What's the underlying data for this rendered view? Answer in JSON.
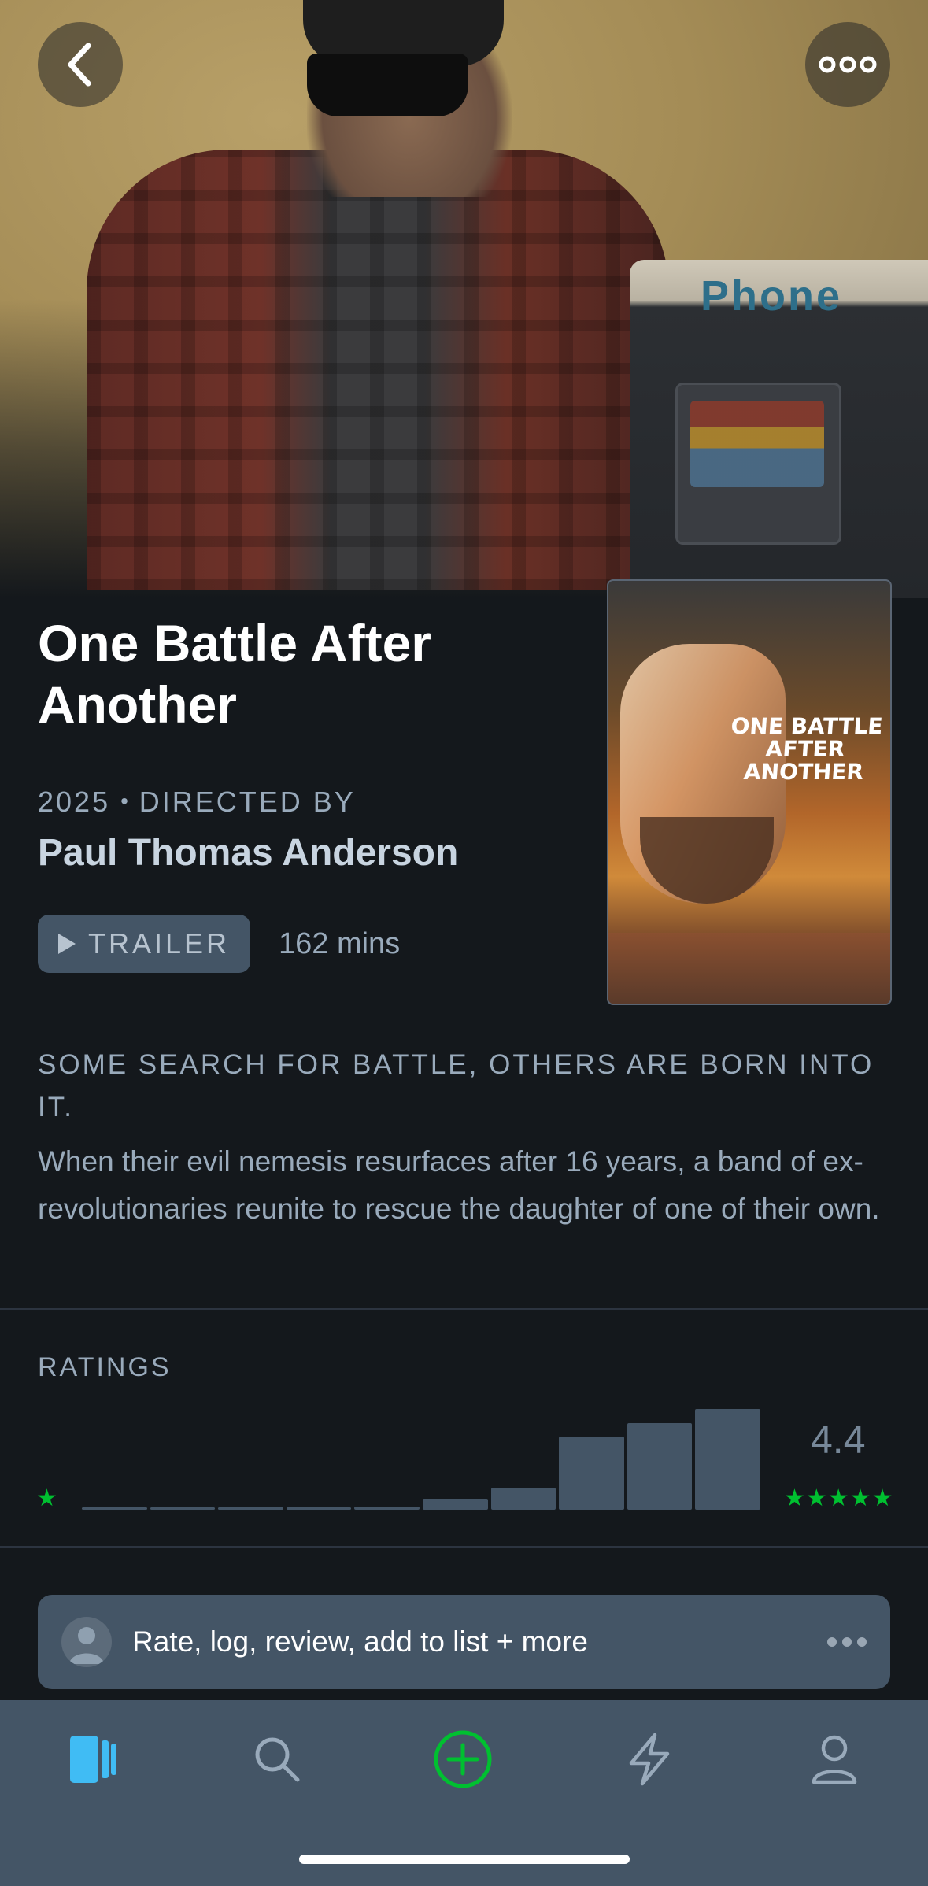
{
  "film": {
    "title": "One Battle After Another",
    "year": "2025",
    "directed_by_label": "DIRECTED BY",
    "director": "Paul Thomas Anderson",
    "trailer_label": "TRAILER",
    "runtime": "162 mins",
    "tagline": "SOME SEARCH FOR BATTLE, OTHERS ARE BORN INTO IT.",
    "synopsis": "When their evil nemesis resurfaces after 16 years, a band of ex-revolutionaries reunite to rescue the daughter of one of their own.",
    "poster_title": "ONE BATTLE AFTER ANOTHER"
  },
  "hero": {
    "phone_sign": "Phone"
  },
  "ratings": {
    "label": "RATINGS",
    "average": "4.4",
    "min_stars": "★",
    "max_stars": "★★★★★",
    "distribution": [
      0.02,
      0.02,
      0.02,
      0.02,
      0.03,
      0.11,
      0.22,
      0.73,
      0.86,
      1.0
    ]
  },
  "action_bar": {
    "label": "Rate, log, review, add to list + more"
  },
  "icons": {
    "back": "chevron-left-icon",
    "more": "ellipsis-icon",
    "tabs": [
      "films-icon",
      "search-icon",
      "add-icon",
      "activity-icon",
      "profile-icon"
    ]
  },
  "colors": {
    "background": "#14181c",
    "accent_green": "#00c030",
    "accent_blue": "#40bcf4",
    "tabbar": "#445566",
    "muted_text": "#99aabb"
  }
}
